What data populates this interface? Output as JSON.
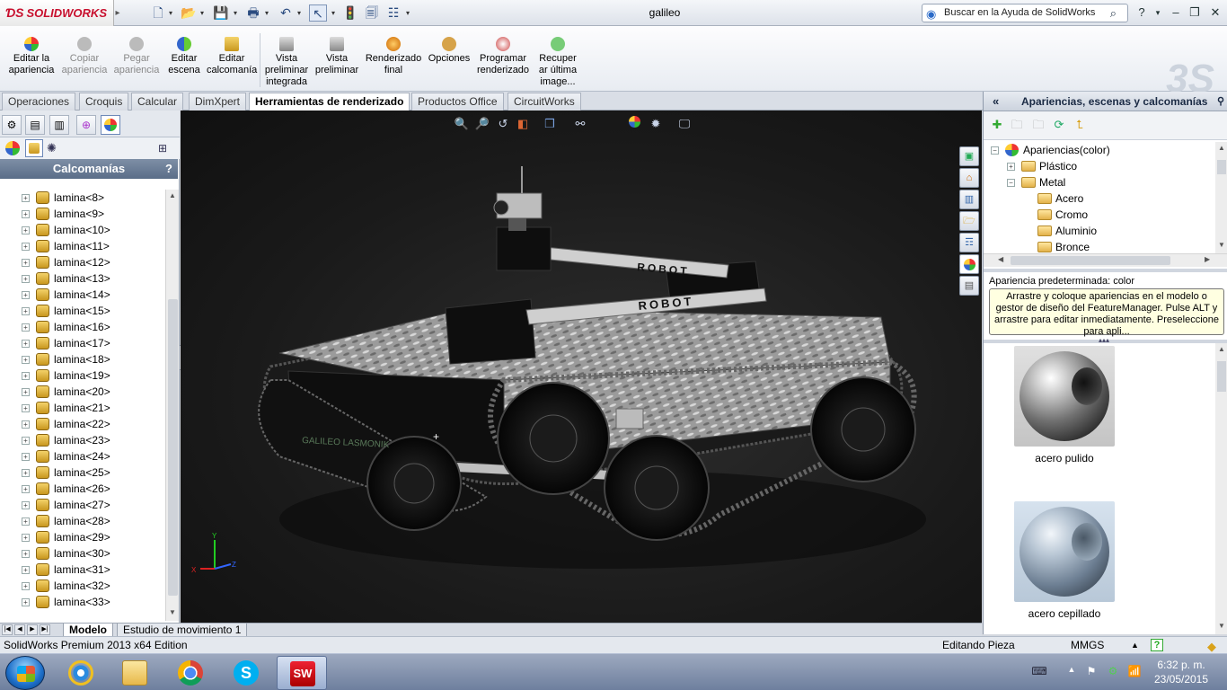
{
  "app": {
    "logo": "SOLIDWORKS",
    "doc_title": "galileo"
  },
  "search": {
    "placeholder": "Buscar en la Ayuda de SolidWorks"
  },
  "ribbon": {
    "buttons": [
      {
        "l1": "Editar la",
        "l2": "apariencia",
        "icon": "appearance-icon",
        "enabled": true
      },
      {
        "l1": "Copiar",
        "l2": "apariencia",
        "icon": "copy-appearance-icon",
        "enabled": false
      },
      {
        "l1": "Pegar",
        "l2": "apariencia",
        "icon": "paste-appearance-icon",
        "enabled": false
      },
      {
        "l1": "Editar",
        "l2": "escena",
        "icon": "scene-icon",
        "enabled": true
      },
      {
        "l1": "Editar",
        "l2": "calcomanía",
        "icon": "decal-icon",
        "enabled": true
      },
      {
        "l1": "Vista",
        "l2": "preliminar",
        "l3": "integrada",
        "icon": "integrated-preview-icon",
        "enabled": true
      },
      {
        "l1": "Vista",
        "l2": "preliminar",
        "icon": "preview-window-icon",
        "enabled": true
      },
      {
        "l1": "Renderizado",
        "l2": "final",
        "icon": "final-render-icon",
        "enabled": true
      },
      {
        "l1": "Opciones",
        "icon": "options-icon",
        "enabled": true
      },
      {
        "l1": "Programar",
        "l2": "renderizado",
        "icon": "schedule-render-icon",
        "enabled": true
      },
      {
        "l1": "Recuper",
        "l2": "ar última",
        "l3": "image...",
        "icon": "recover-image-icon",
        "enabled": true
      }
    ]
  },
  "tabs": [
    "Operaciones",
    "Croquis",
    "Calcular",
    "DimXpert",
    "Herramientas de renderizado",
    "Productos Office",
    "CircuitWorks"
  ],
  "active_tab": "Herramientas de renderizado",
  "left_panel": {
    "header": "Calcomanías",
    "help": "?",
    "items": [
      "lamina<8>",
      "lamina<9>",
      "lamina<10>",
      "lamina<11>",
      "lamina<12>",
      "lamina<13>",
      "lamina<14>",
      "lamina<15>",
      "lamina<16>",
      "lamina<17>",
      "lamina<18>",
      "lamina<19>",
      "lamina<20>",
      "lamina<21>",
      "lamina<22>",
      "lamina<23>",
      "lamina<24>",
      "lamina<25>",
      "lamina<26>",
      "lamina<27>",
      "lamina<28>",
      "lamina<29>",
      "lamina<30>",
      "lamina<31>",
      "lamina<32>",
      "lamina<33>"
    ]
  },
  "viewport": {
    "model_text": [
      "ROBOT",
      "ROBOT",
      "GALILEO LASMONIK"
    ],
    "axis": {
      "x": "X",
      "y": "Y",
      "z": "Z"
    },
    "cursor": "+"
  },
  "right_panel": {
    "header": "Apariencias, escenas y calcomanías",
    "tree": [
      {
        "label": "Apariencias(color)",
        "level": 0,
        "expander": "−",
        "icon": "appearance-ball"
      },
      {
        "label": "Plástico",
        "level": 1,
        "expander": "+",
        "icon": "folder"
      },
      {
        "label": "Metal",
        "level": 1,
        "expander": "−",
        "icon": "folder"
      },
      {
        "label": "Acero",
        "level": 2,
        "icon": "folder"
      },
      {
        "label": "Cromo",
        "level": 2,
        "icon": "folder"
      },
      {
        "label": "Aluminio",
        "level": 2,
        "icon": "folder"
      },
      {
        "label": "Bronce",
        "level": 2,
        "icon": "folder"
      }
    ],
    "default_label": "Apariencia predeterminada: color",
    "tooltip": "Arrastre y coloque apariencias en el modelo o gestor de diseño del FeatureManager. Pulse ALT y arrastre para editar inmediatamente. Preseleccione para apli...",
    "swatches": [
      {
        "label": "acero pulido"
      },
      {
        "label": "acero cepillado"
      }
    ]
  },
  "bottom_tabs": [
    "Modelo",
    "Estudio de movimiento 1"
  ],
  "status": {
    "left": "SolidWorks Premium 2013 x64 Edition",
    "mode": "Editando Pieza",
    "units": "MMGS",
    "help": "?"
  },
  "clock": {
    "time": "6:32 p. m.",
    "date": "23/05/2015"
  }
}
